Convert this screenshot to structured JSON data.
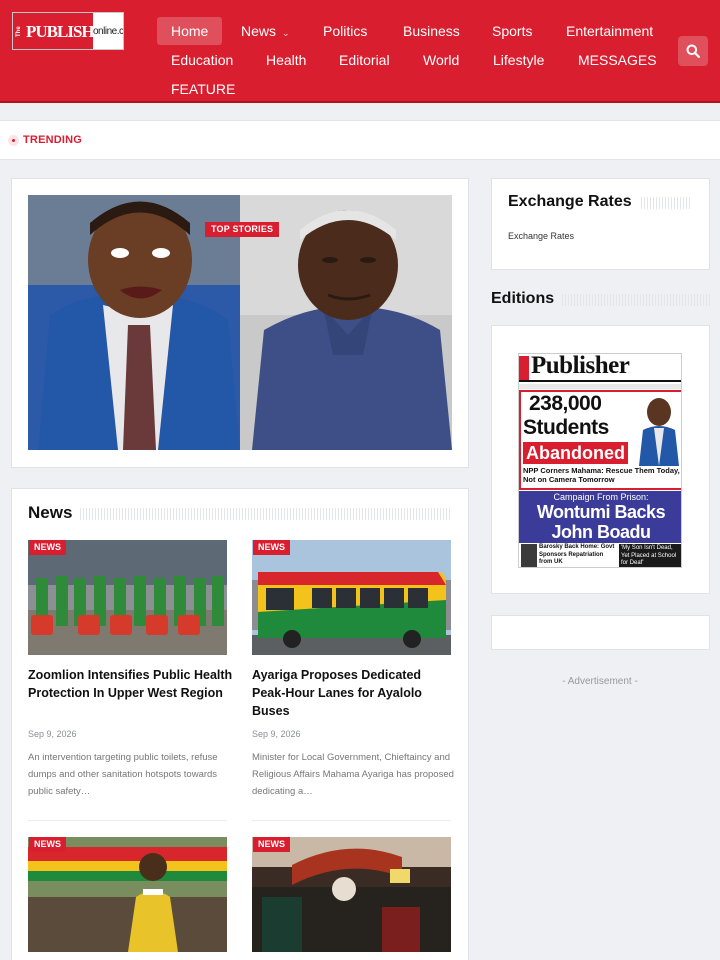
{
  "header": {
    "logo": {
      "the": "The",
      "publisher": "PUBLISHER",
      "domain": "online.com"
    },
    "nav": [
      {
        "label": "Home",
        "active": true
      },
      {
        "label": "News",
        "has_dropdown": true
      },
      {
        "label": "Politics"
      },
      {
        "label": "Business"
      },
      {
        "label": "Sports"
      },
      {
        "label": "Entertainment"
      },
      {
        "label": "Education"
      },
      {
        "label": "Health"
      },
      {
        "label": "Editorial"
      },
      {
        "label": "World"
      },
      {
        "label": "Lifestyle"
      },
      {
        "label": "MESSAGES"
      },
      {
        "label": "FEATURE"
      }
    ],
    "search_icon": "search-icon"
  },
  "trending": {
    "label": "TRENDING"
  },
  "featured": {
    "badge": "TOP STORIES"
  },
  "news": {
    "title": "News",
    "items": [
      {
        "badge": "NEWS",
        "title": "Zoomlion Intensifies Public Health Protection In Upper West Region",
        "date": "Sep 9, 2026",
        "excerpt": "An intervention targeting public toilets, refuse dumps and other sanitation hotspots towards public safety…"
      },
      {
        "badge": "NEWS",
        "title": "Ayariga Proposes Dedicated Peak-Hour Lanes for Ayalolo Buses",
        "date": "Sep 9, 2026",
        "excerpt": "Minister for Local Government, Chieftaincy and Religious Affairs Mahama Ayariga has proposed dedicating a…"
      },
      {
        "badge": "NEWS"
      },
      {
        "badge": "NEWS"
      }
    ]
  },
  "sidebar": {
    "exchange_rates": {
      "title": "Exchange Rates",
      "content": "Exchange Rates"
    },
    "editions": {
      "title": "Editions",
      "paper": {
        "masthead": "Publisher",
        "headline_num": "238,000",
        "headline_line2": "Students",
        "headline_line3": "Abandoned",
        "sub1": "NPP Corners Mahama: Rescue Them Today, Not on Camera Tomorrow",
        "kicker": "Campaign From Prison:",
        "headline2_a": "Wontumi Backs",
        "headline2_b": "John Boadu",
        "foot_left": "Barosky Back Home: Govt Sponsors Repatriation from UK",
        "foot_right": "'My Son Isn't Dead, Yet Placed at School for Deaf'"
      }
    },
    "advertisement": "- Advertisement -"
  },
  "colors": {
    "brand_red": "#d81e2f",
    "paper_blue": "#3b3b9a"
  }
}
